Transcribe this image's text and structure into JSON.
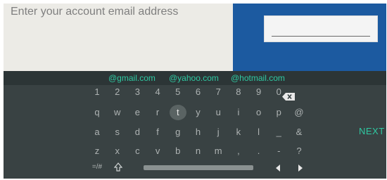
{
  "prompt": {
    "text": "Enter your account email address"
  },
  "email_field": {
    "value": ""
  },
  "suggestions": [
    "@gmail.com",
    "@yahoo.com",
    "@hotmail.com"
  ],
  "keyboard": {
    "rows": [
      [
        "1",
        "2",
        "3",
        "4",
        "5",
        "6",
        "7",
        "8",
        "9",
        "0"
      ],
      [
        "q",
        "w",
        "e",
        "r",
        "t",
        "y",
        "u",
        "i",
        "o",
        "p",
        "@"
      ],
      [
        "a",
        "s",
        "d",
        "f",
        "g",
        "h",
        "j",
        "k",
        "l",
        "_",
        "&"
      ],
      [
        "z",
        "x",
        "c",
        "v",
        "b",
        "n",
        "m",
        ",",
        ".",
        "-",
        "?"
      ]
    ],
    "selected_key": "t",
    "symbols_label": "=/#",
    "next_label": "NEXT"
  },
  "colors": {
    "accent": "#2fc9a2",
    "blue_pane": "#1c5aa0",
    "keyboard_bg": "#394243"
  },
  "icons": [
    "backspace-icon",
    "shift-icon",
    "arrow-left-icon",
    "arrow-right-icon"
  ]
}
